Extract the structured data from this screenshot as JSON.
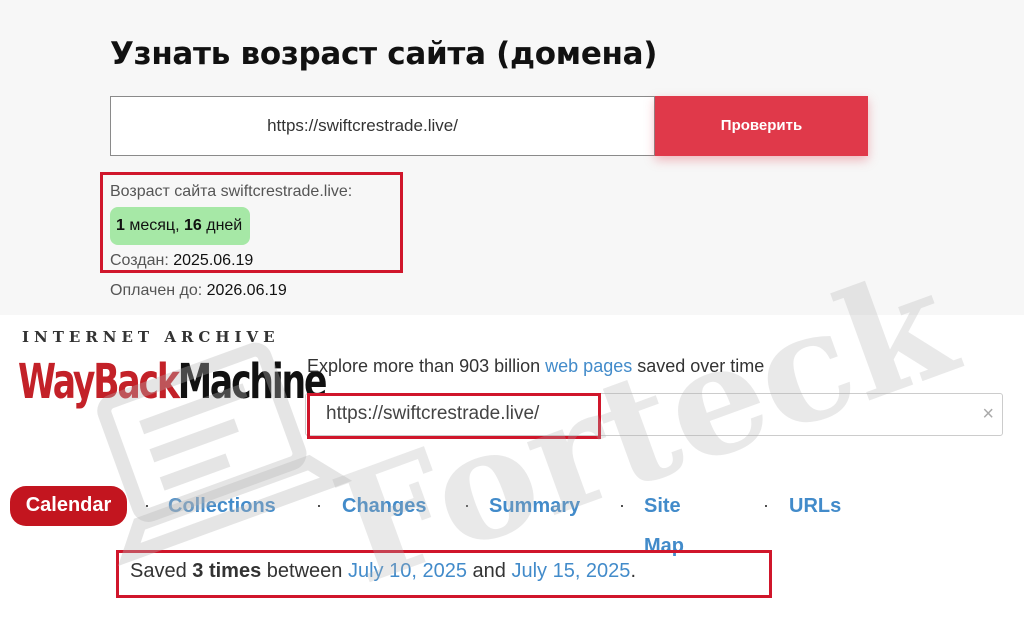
{
  "age_checker": {
    "title": "Узнать возраст сайта (домена)",
    "domain_value": "https://swiftcrestrade.live/",
    "check_button": "Проверить",
    "age_label": "Возраст сайта swiftcrestrade.live:",
    "age_months_num": "1",
    "age_months_word": "месяц,",
    "age_days_num": "16",
    "age_days_word": "дней",
    "created_label": "Создан:",
    "created_value": "2025.06.19",
    "paid_label": "Оплачен до:",
    "paid_value": "2026.06.19"
  },
  "wayback": {
    "ia_text": "INTERNET ARCHIVE",
    "logo_way": "WayBack",
    "logo_machine": "Machine",
    "explore_prefix": "Explore more than 903 billion",
    "explore_link": "web pages",
    "explore_suffix": "saved over time",
    "search_value": "https://swiftcrestrade.live/",
    "clear_glyph": "×",
    "tabs": {
      "calendar": "Calendar",
      "collections": "Collections",
      "changes": "Changes",
      "summary": "Summary",
      "site_map": "Site Map",
      "urls": "URLs"
    },
    "separator": "·",
    "saved_prefix": "Saved",
    "saved_count": "3 times",
    "saved_between": "between",
    "date_first": "July 10, 2025",
    "saved_and": "and",
    "date_last": "July 15, 2025",
    "saved_period": "."
  },
  "watermark": {
    "text": "Forteck",
    "icon": "laptop-watermark-icon"
  },
  "colors": {
    "accent_red": "#e0394a",
    "highlight_red": "#d0162b",
    "link_blue": "#428bca",
    "badge_green": "#a6e8a6",
    "wayback_red": "#c3151f"
  }
}
